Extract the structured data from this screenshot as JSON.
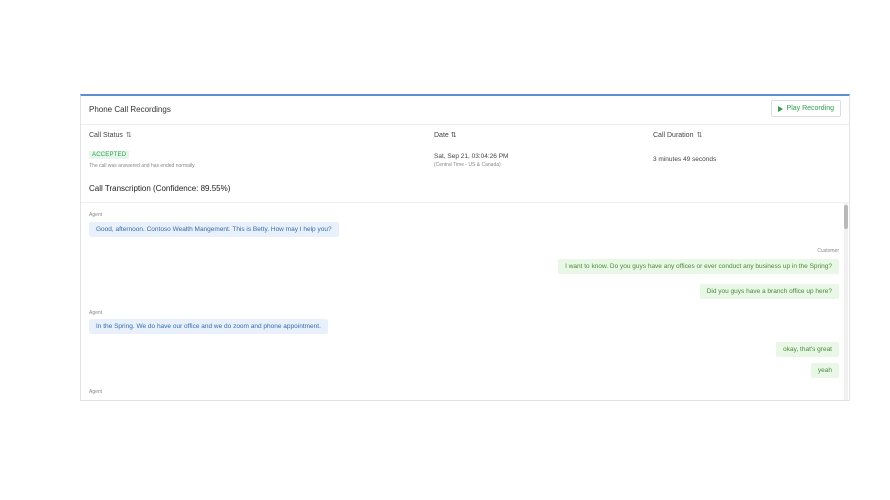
{
  "panel": {
    "title": "Phone Call Recordings",
    "play_label": "Play Recording"
  },
  "columns": {
    "status_label": "Call Status",
    "date_label": "Date ⇅",
    "duration_label": "Call Duration"
  },
  "status": {
    "badge": "ACCEPTED",
    "description": "The call was answered and has ended normally."
  },
  "date": {
    "value": "Sat, Sep 21, 03:04:26 PM",
    "timezone": "(Central Time - US & Canada)"
  },
  "duration": {
    "value": "3 minutes 49 seconds"
  },
  "transcription": {
    "title": "Call Transcription (Confidence: 89.55%)",
    "agent_label": "Agent",
    "customer_label": "Customer",
    "messages": [
      {
        "speaker": "agent",
        "text": "Good, afternoon. Contoso Wealth Mangement. This is Betty. How may I help you?"
      },
      {
        "speaker": "customer",
        "text": "I want to know. Do you guys have any offices or ever conduct any business up in the Spring?"
      },
      {
        "speaker": "customer",
        "text": "Did you guys have a branch office up here?"
      },
      {
        "speaker": "agent",
        "text": "In the Spring. We do have our office and we do zoom and phone appointment."
      },
      {
        "speaker": "customer",
        "text": "okay, that's great"
      },
      {
        "speaker": "customer",
        "text": "yeah"
      }
    ]
  },
  "colors": {
    "accent": "#5b8fd4",
    "success": "#2e9e4f",
    "agent_bubble": "#e8f1fb",
    "customer_bubble": "#e9f7e6"
  },
  "icons": {
    "play": "play-icon",
    "sort": "sort-icon"
  }
}
